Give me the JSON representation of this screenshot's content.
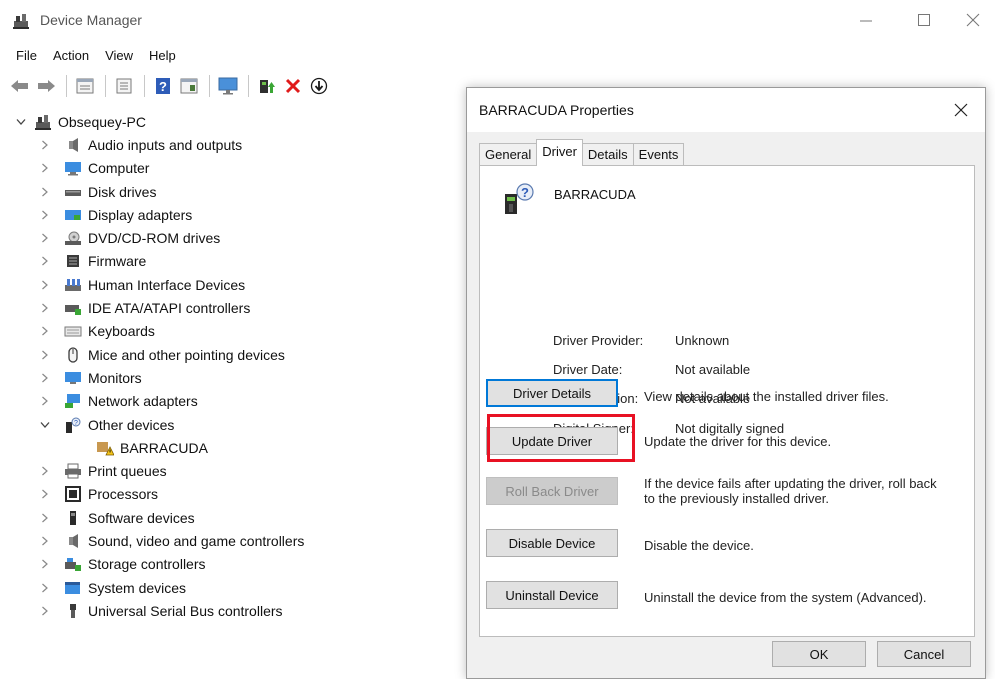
{
  "window": {
    "title": "Device Manager",
    "icons": {
      "app": "device-manager-icon",
      "minimize": "minimize-icon",
      "maximize": "maximize-icon",
      "close": "close-icon"
    }
  },
  "menu": {
    "items": [
      "File",
      "Action",
      "View",
      "Help"
    ]
  },
  "toolbar": {
    "icons": [
      "back-arrow-icon",
      "forward-arrow-icon",
      "properties-grid-icon",
      "list-view-icon",
      "help-icon",
      "driver-icon",
      "monitor-scan-icon",
      "update-driver-icon",
      "uninstall-x-icon",
      "download-circle-icon"
    ]
  },
  "tree": {
    "root": "Obsequey-PC",
    "items": [
      {
        "label": "Audio inputs and outputs",
        "icon": "speaker-icon",
        "expanded": false
      },
      {
        "label": "Computer",
        "icon": "computer-icon",
        "expanded": false
      },
      {
        "label": "Disk drives",
        "icon": "disk-drive-icon",
        "expanded": false
      },
      {
        "label": "Display adapters",
        "icon": "display-adapter-icon",
        "expanded": false
      },
      {
        "label": "DVD/CD-ROM drives",
        "icon": "dvd-icon",
        "expanded": false
      },
      {
        "label": "Firmware",
        "icon": "firmware-icon",
        "expanded": false
      },
      {
        "label": "Human Interface Devices",
        "icon": "hid-icon",
        "expanded": false
      },
      {
        "label": "IDE ATA/ATAPI controllers",
        "icon": "ide-controller-icon",
        "expanded": false
      },
      {
        "label": "Keyboards",
        "icon": "keyboard-icon",
        "expanded": false
      },
      {
        "label": "Mice and other pointing devices",
        "icon": "mouse-icon",
        "expanded": false
      },
      {
        "label": "Monitors",
        "icon": "monitor-icon",
        "expanded": false
      },
      {
        "label": "Network adapters",
        "icon": "network-adapter-icon",
        "expanded": false
      },
      {
        "label": "Other devices",
        "icon": "unknown-device-icon",
        "expanded": true
      },
      {
        "label": "BARRACUDA",
        "icon": "warning-device-icon",
        "child": true
      },
      {
        "label": "Print queues",
        "icon": "printer-icon",
        "expanded": false
      },
      {
        "label": "Processors",
        "icon": "processor-icon",
        "expanded": false
      },
      {
        "label": "Software devices",
        "icon": "software-device-icon",
        "expanded": false
      },
      {
        "label": "Sound, video and game controllers",
        "icon": "sound-controller-icon",
        "expanded": false
      },
      {
        "label": "Storage controllers",
        "icon": "storage-controller-icon",
        "expanded": false
      },
      {
        "label": "System devices",
        "icon": "system-device-icon",
        "expanded": false
      },
      {
        "label": "Universal Serial Bus controllers",
        "icon": "usb-icon",
        "expanded": false
      }
    ]
  },
  "dialog": {
    "title": "BARRACUDA Properties",
    "tabs": [
      "General",
      "Driver",
      "Details",
      "Events"
    ],
    "active_tab": "Driver",
    "device_name": "BARRACUDA",
    "props": [
      {
        "label": "Driver Provider:",
        "value": "Unknown"
      },
      {
        "label": "Driver Date:",
        "value": "Not available"
      },
      {
        "label": "Driver Version:",
        "value": "Not available"
      },
      {
        "label": "Digital Signer:",
        "value": "Not digitally signed"
      }
    ],
    "actions": [
      {
        "label": "Driver Details",
        "desc": "View details about the installed driver files."
      },
      {
        "label": "Update Driver",
        "desc": "Update the driver for this device."
      },
      {
        "label": "Roll Back Driver",
        "desc": "If the device fails after updating the driver, roll back to the previously installed driver."
      },
      {
        "label": "Disable Device",
        "desc": "Disable the device."
      },
      {
        "label": "Uninstall Device",
        "desc": "Uninstall the device from the system (Advanced)."
      }
    ],
    "ok_label": "OK",
    "cancel_label": "Cancel",
    "highlight_color": "#e81123"
  }
}
